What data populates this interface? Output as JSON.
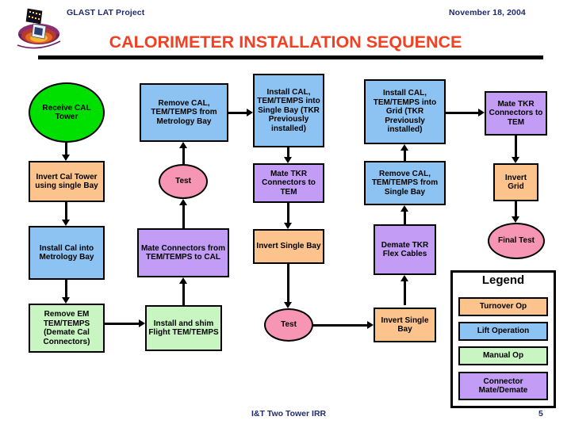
{
  "header": {
    "project": "GLAST LAT Project",
    "date": "November 18, 2004",
    "title": "CALORIMETER INSTALLATION SEQUENCE",
    "logo_icon": "glast-satellite-logo-icon"
  },
  "footer": {
    "title": "I&T Two Tower IRR",
    "page": "5"
  },
  "colors": {
    "turnover_op": "#fcc48c",
    "lift_operation": "#8cc3f2",
    "manual_op": "#c9f5c2",
    "connector_mate_demate": "#c39cf5",
    "test": "#f795b4",
    "start": "#00e000",
    "title_red": "#ef4123",
    "header_blue": "#1f2a6e",
    "outline": "#000000"
  },
  "flowchart": {
    "type": "process-flow-diagram",
    "nodes": [
      {
        "id": "n1",
        "label": "Receive CAL Tower",
        "shape": "ellipse",
        "color_key": "start",
        "column": 1,
        "row": 1
      },
      {
        "id": "n2",
        "label": "Invert Cal Tower using single Bay",
        "shape": "rectangle",
        "color_key": "turnover_op",
        "column": 1,
        "row": 2
      },
      {
        "id": "n3",
        "label": "Install Cal into Metrology Bay",
        "shape": "rectangle",
        "color_key": "lift_operation",
        "column": 1,
        "row": 3
      },
      {
        "id": "n4",
        "label": "Remove EM TEM/TEMPS (Demate Cal Connectors)",
        "shape": "rectangle",
        "color_key": "manual_op",
        "column": 1,
        "row": 4
      },
      {
        "id": "n5",
        "label": "Remove CAL, TEM/TEMPS from Metrology Bay",
        "shape": "rectangle",
        "color_key": "lift_operation",
        "column": 2,
        "row": 1
      },
      {
        "id": "n6",
        "label": "Test",
        "shape": "ellipse",
        "color_key": "test",
        "column": 2,
        "row": 2
      },
      {
        "id": "n7",
        "label": "Mate Connectors from TEM/TEMPS to CAL",
        "shape": "rectangle",
        "color_key": "connector_mate_demate",
        "column": 2,
        "row": 3
      },
      {
        "id": "n8",
        "label": "Install and shim Flight TEM/TEMPS",
        "shape": "rectangle",
        "color_key": "manual_op",
        "column": 2,
        "row": 4
      },
      {
        "id": "n9",
        "label": "Install CAL, TEM/TEMPS into Single Bay (TKR Previously installed)",
        "shape": "rectangle",
        "color_key": "lift_operation",
        "column": 3,
        "row": 1
      },
      {
        "id": "n10",
        "label": "Mate TKR Connectors to TEM",
        "shape": "rectangle",
        "color_key": "connector_mate_demate",
        "column": 3,
        "row": 2
      },
      {
        "id": "n11",
        "label": "Invert Single Bay",
        "shape": "rectangle",
        "color_key": "turnover_op",
        "column": 3,
        "row": 3
      },
      {
        "id": "n12",
        "label": "Test",
        "shape": "ellipse",
        "color_key": "test",
        "column": 3,
        "row": 4
      },
      {
        "id": "n13",
        "label": "Install CAL, TEM/TEMPS into Grid (TKR Previously installed)",
        "shape": "rectangle",
        "color_key": "lift_operation",
        "column": 4,
        "row": 1
      },
      {
        "id": "n14",
        "label": "Remove CAL, TEM/TEMPS from Single Bay",
        "shape": "rectangle",
        "color_key": "lift_operation",
        "column": 4,
        "row": 2
      },
      {
        "id": "n15",
        "label": "Demate TKR Flex Cables",
        "shape": "rectangle",
        "color_key": "connector_mate_demate",
        "column": 4,
        "row": 3
      },
      {
        "id": "n16",
        "label": "Invert Single Bay",
        "shape": "rectangle",
        "color_key": "turnover_op",
        "column": 4,
        "row": 4
      },
      {
        "id": "n17",
        "label": "Mate TKR Connectors to TEM",
        "shape": "rectangle",
        "color_key": "connector_mate_demate",
        "column": 5,
        "row": 1
      },
      {
        "id": "n18",
        "label": "Invert Grid",
        "shape": "rectangle",
        "color_key": "turnover_op",
        "column": 5,
        "row": 2
      },
      {
        "id": "n19",
        "label": "Final Test",
        "shape": "ellipse",
        "color_key": "test",
        "column": 5,
        "row": 3
      }
    ],
    "edges": [
      {
        "from": "n1",
        "to": "n2",
        "direction": "down"
      },
      {
        "from": "n2",
        "to": "n3",
        "direction": "down"
      },
      {
        "from": "n3",
        "to": "n4",
        "direction": "down"
      },
      {
        "from": "n4",
        "to": "n8",
        "direction": "right"
      },
      {
        "from": "n8",
        "to": "n7",
        "direction": "up"
      },
      {
        "from": "n7",
        "to": "n6",
        "direction": "up"
      },
      {
        "from": "n6",
        "to": "n5",
        "direction": "up"
      },
      {
        "from": "n5",
        "to": "n9",
        "direction": "right"
      },
      {
        "from": "n9",
        "to": "n10",
        "direction": "down"
      },
      {
        "from": "n10",
        "to": "n11",
        "direction": "down"
      },
      {
        "from": "n11",
        "to": "n12",
        "direction": "down"
      },
      {
        "from": "n12",
        "to": "n16",
        "direction": "right"
      },
      {
        "from": "n16",
        "to": "n15",
        "direction": "up"
      },
      {
        "from": "n15",
        "to": "n14",
        "direction": "up"
      },
      {
        "from": "n14",
        "to": "n13",
        "direction": "up"
      },
      {
        "from": "n13",
        "to": "n17",
        "direction": "right"
      },
      {
        "from": "n17",
        "to": "n18",
        "direction": "down"
      },
      {
        "from": "n18",
        "to": "n19",
        "direction": "down"
      }
    ]
  },
  "legend": {
    "title": "Legend",
    "items": [
      {
        "label": "Turnover Op",
        "color_key": "turnover_op"
      },
      {
        "label": "Lift Operation",
        "color_key": "lift_operation"
      },
      {
        "label": "Manual Op",
        "color_key": "manual_op"
      },
      {
        "label": "Connector Mate/Demate",
        "color_key": "connector_mate_demate"
      }
    ]
  }
}
